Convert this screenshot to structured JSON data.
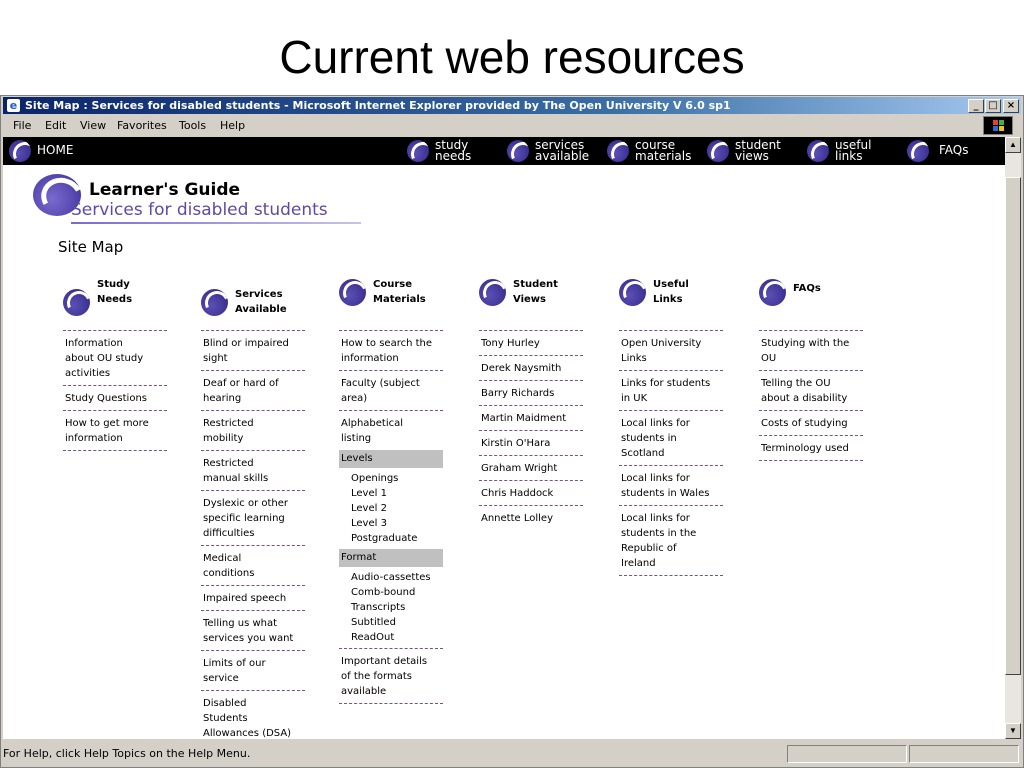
{
  "slide": {
    "title": "Current web resources"
  },
  "window": {
    "title": "Site Map : Services for disabled students - Microsoft Internet Explorer provided by The Open University V 6.0 sp1",
    "controls": {
      "minimize": "_",
      "maximize": "□",
      "close": "×"
    }
  },
  "menu": [
    "File",
    "Edit",
    "View",
    "Favorites",
    "Tools",
    "Help"
  ],
  "nav": {
    "home": "HOME",
    "items": [
      {
        "line1": "study",
        "line2": "needs"
      },
      {
        "line1": "services",
        "line2": "available"
      },
      {
        "line1": "course",
        "line2": "materials"
      },
      {
        "line1": "student",
        "line2": "views"
      },
      {
        "line1": "useful",
        "line2": "links"
      }
    ],
    "faqs": "FAQs"
  },
  "header": {
    "title": "Learner's Guide",
    "subtitle": "Services for disabled students"
  },
  "sitemap_heading": "Site Map",
  "columns": {
    "study_needs": {
      "head1": "Study",
      "head2": "Needs",
      "entries": [
        [
          "Information",
          "about OU study",
          "activities"
        ],
        [
          "Study Questions"
        ],
        [
          "How to get more",
          "information"
        ]
      ]
    },
    "services": {
      "head1": "Services",
      "head2": "Available",
      "entries": [
        [
          "Blind or impaired",
          "sight"
        ],
        [
          "Deaf or hard of",
          "hearing"
        ],
        [
          "Restricted",
          "mobility"
        ],
        [
          "Restricted",
          "manual skills"
        ],
        [
          "Dyslexic or other",
          "specific learning",
          "difficulties"
        ],
        [
          "Medical",
          "conditions"
        ],
        [
          "Impaired speech"
        ],
        [
          "Telling us what",
          "services you want"
        ],
        [
          "Limits of our",
          "service"
        ],
        [
          "Disabled",
          "Students",
          "Allowances (DSA)"
        ]
      ]
    },
    "course": {
      "head1": "Course",
      "head2": "Materials",
      "entries": [
        [
          "How to search the",
          "information"
        ],
        [
          "Faculty (subject",
          "area)"
        ],
        [
          "Alphabetical",
          "listing"
        ]
      ],
      "levels_header": "Levels",
      "levels": [
        "Openings",
        "Level 1",
        "Level 2",
        "Level 3",
        "Postgraduate"
      ],
      "format_header": "Format",
      "formats": [
        "Audio-cassettes",
        "Comb-bound",
        "Transcripts",
        "Subtitled",
        "ReadOut"
      ],
      "details": [
        "Important details",
        "of the formats",
        "available"
      ]
    },
    "student_views": {
      "head1": "Student",
      "head2": "Views",
      "entries": [
        [
          "Tony Hurley"
        ],
        [
          "Derek Naysmith"
        ],
        [
          "Barry Richards"
        ],
        [
          "Martin Maidment"
        ],
        [
          "Kirstin O'Hara"
        ],
        [
          "Graham Wright"
        ],
        [
          "Chris Haddock"
        ],
        [
          "Annette Lolley"
        ]
      ]
    },
    "useful_links": {
      "head1": "Useful",
      "head2": "Links",
      "entries": [
        [
          "Open University",
          "Links"
        ],
        [
          "Links for students",
          "in UK"
        ],
        [
          "Local links for",
          "students in",
          "Scotland"
        ],
        [
          "Local links for",
          "students in Wales"
        ],
        [
          "Local links for",
          "students in the",
          "Republic of",
          "Ireland"
        ]
      ]
    },
    "faqs": {
      "head1": "FAQs",
      "entries": [
        [
          "Studying with the",
          "OU"
        ],
        [
          "Telling the OU",
          "about a disability"
        ],
        [
          "Costs of studying"
        ],
        [
          "Terminology used"
        ]
      ]
    }
  },
  "status": {
    "text": "For Help, click Help Topics on the Help Menu."
  }
}
